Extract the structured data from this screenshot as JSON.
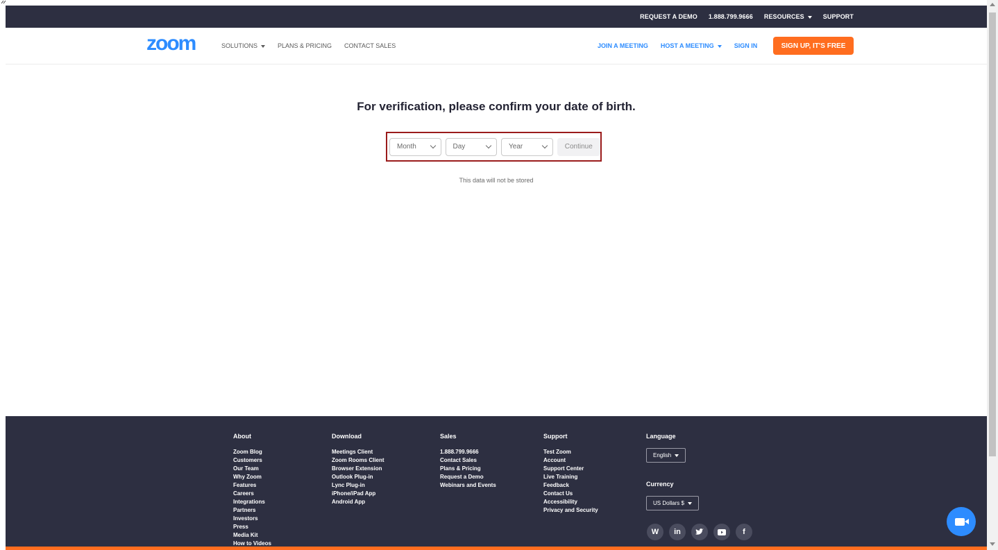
{
  "topbar": {
    "request_demo": "REQUEST A DEMO",
    "phone": "1.888.799.9666",
    "resources": "RESOURCES",
    "support": "SUPPORT"
  },
  "nav": {
    "logo": "zoom",
    "solutions": "SOLUTIONS",
    "plans_pricing": "PLANS & PRICING",
    "contact_sales": "CONTACT SALES",
    "join_meeting": "JOIN A MEETING",
    "host_meeting": "HOST A MEETING",
    "sign_in": "SIGN IN",
    "signup": "SIGN UP, IT'S FREE"
  },
  "main": {
    "headline": "For verification, please confirm your date of birth.",
    "month": "Month",
    "day": "Day",
    "year": "Year",
    "continue": "Continue",
    "note": "This data will not be stored"
  },
  "footer": {
    "about": {
      "heading": "About",
      "items": [
        "Zoom Blog",
        "Customers",
        "Our Team",
        "Why Zoom",
        "Features",
        "Careers",
        "Integrations",
        "Partners",
        "Investors",
        "Press",
        "Media Kit",
        "How to Videos"
      ]
    },
    "download": {
      "heading": "Download",
      "items": [
        "Meetings Client",
        "Zoom Rooms Client",
        "Browser Extension",
        "Outlook Plug-in",
        "Lync Plug-in",
        "iPhone/iPad App",
        "Android App"
      ]
    },
    "sales": {
      "heading": "Sales",
      "items": [
        "1.888.799.9666",
        "Contact Sales",
        "Plans & Pricing",
        "Request a Demo",
        "Webinars and Events"
      ]
    },
    "support": {
      "heading": "Support",
      "items": [
        "Test Zoom",
        "Account",
        "Support Center",
        "Live Training",
        "Feedback",
        "Contact Us",
        "Accessibility",
        "Privacy and Security"
      ]
    },
    "language": {
      "heading": "Language",
      "value": "English"
    },
    "currency": {
      "heading": "Currency",
      "value": "US Dollars $"
    },
    "social": [
      "wordpress-icon",
      "linkedin-icon",
      "twitter-icon",
      "youtube-icon",
      "facebook-icon"
    ]
  },
  "colors": {
    "brand_blue": "#2d8cff",
    "orange": "#ff6d1f",
    "dark": "#2d2f41",
    "highlight_border": "#9a1b1b"
  }
}
